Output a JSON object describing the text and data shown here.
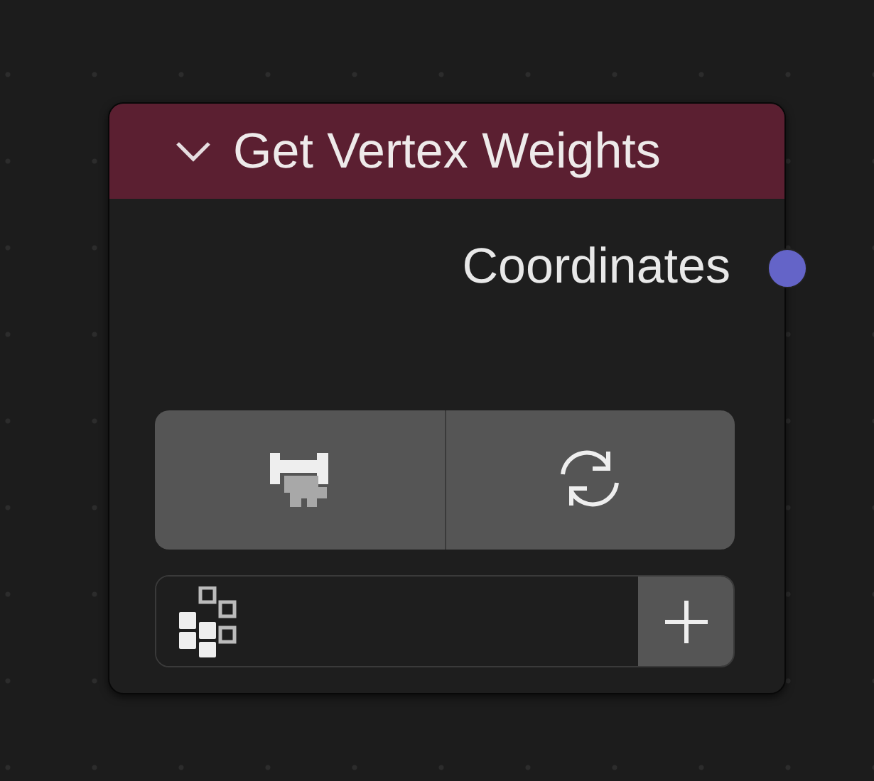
{
  "node": {
    "title": "Get Vertex Weights",
    "expanded": true,
    "color": "#5b1f31"
  },
  "outputs": [
    {
      "label": "Coordinates",
      "color": "#6464c8"
    }
  ],
  "buttons": [
    {
      "kind": "weights"
    },
    {
      "kind": "refresh"
    }
  ],
  "field": {
    "kind": "attribute"
  }
}
